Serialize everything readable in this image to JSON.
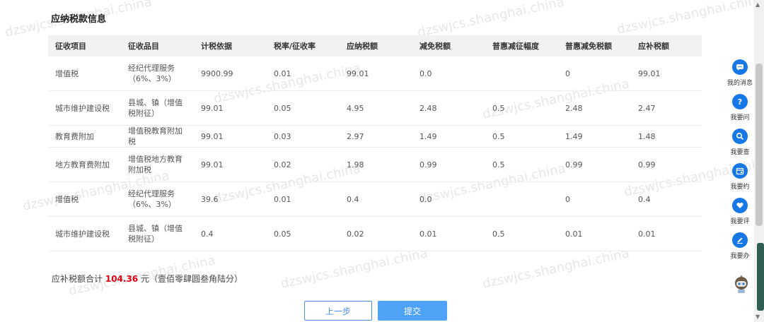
{
  "section_title": "应纳税款信息",
  "table": {
    "headers": [
      "征收项目",
      "征收品目",
      "计税依据",
      "税率/征收率",
      "应纳税额",
      "减免税额",
      "普惠减征幅度",
      "普惠减免税额",
      "应补税额"
    ],
    "rows": [
      [
        "增值税",
        "经纪代理服务（6%、3%）",
        "9900.99",
        "0.01",
        "99.01",
        "0.0",
        "",
        "0",
        "99.01"
      ],
      [
        "城市维护建设税",
        "县城、镇（增值税附征）",
        "99.01",
        "0.05",
        "4.95",
        "2.48",
        "0.5",
        "2.48",
        "2.47"
      ],
      [
        "教育费附加",
        "增值税教育附加税",
        "99.01",
        "0.03",
        "2.97",
        "1.49",
        "0.5",
        "1.49",
        "1.48"
      ],
      [
        "地方教育费附加",
        "增值税地方教育附加税",
        "99.01",
        "0.02",
        "1.98",
        "0.99",
        "0.5",
        "0.99",
        "0.99"
      ],
      [
        "增值税",
        "经纪代理服务（6%、3%）",
        "39.6",
        "0.01",
        "0.4",
        "0.0",
        "",
        "0",
        "0.4"
      ],
      [
        "城市维护建设税",
        "县城、镇（增值税附征）",
        "0.4",
        "0.05",
        "0.02",
        "0.01",
        "0.5",
        "0.01",
        "0.01"
      ]
    ]
  },
  "summary": {
    "prefix": "应补税额合计",
    "amount": "104.36",
    "suffix": "元（壹佰零肆圆叁角陆分）"
  },
  "buttons": {
    "prev": "上一步",
    "submit": "提交"
  },
  "watermark_text": "dzswjcs.shanghai.china",
  "side_menu": [
    {
      "label": "我的消息",
      "icon": "message-icon"
    },
    {
      "label": "我要问",
      "icon": "question-icon"
    },
    {
      "label": "我要查",
      "icon": "search-icon"
    },
    {
      "label": "我要约",
      "icon": "calendar-icon"
    },
    {
      "label": "我要评",
      "icon": "heart-icon"
    },
    {
      "label": "我要办",
      "icon": "edit-icon"
    }
  ],
  "colors": {
    "accent": "#1677e6",
    "amount": "#e0000f",
    "submit_bg": "#4fa3f7",
    "header_bg": "#f2f2f2"
  }
}
